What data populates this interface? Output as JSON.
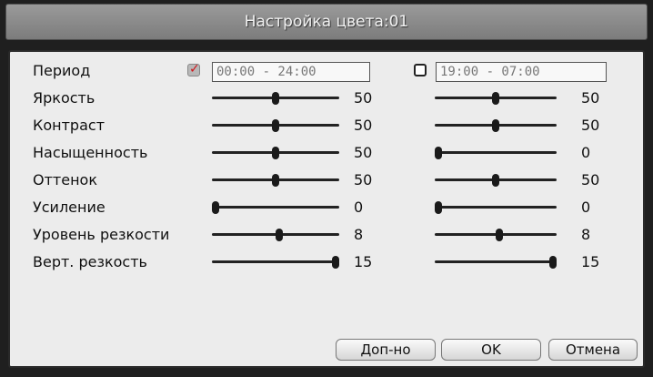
{
  "window": {
    "title": "Настройка цвета:01"
  },
  "period": {
    "label": "Период",
    "slot1": {
      "checked": true,
      "time": "00:00  -  24:00"
    },
    "slot2": {
      "checked": false,
      "time": "19:00  -  07:00"
    }
  },
  "rows": [
    {
      "label": "Яркость",
      "left": {
        "value": "50",
        "level": 0.5
      },
      "right": {
        "value": "50",
        "level": 0.5
      }
    },
    {
      "label": "Контраст",
      "left": {
        "value": "50",
        "level": 0.5
      },
      "right": {
        "value": "50",
        "level": 0.5
      }
    },
    {
      "label": "Насыщенность",
      "left": {
        "value": "50",
        "level": 0.5
      },
      "right": {
        "value": "0",
        "level": 0.0
      }
    },
    {
      "label": "Оттенок",
      "left": {
        "value": "50",
        "level": 0.5
      },
      "right": {
        "value": "50",
        "level": 0.5
      }
    },
    {
      "label": "Усиление",
      "left": {
        "value": "0",
        "level": 0.0
      },
      "right": {
        "value": "0",
        "level": 0.0
      }
    },
    {
      "label": "Уровень резкости",
      "left": {
        "value": "8",
        "level": 0.53
      },
      "right": {
        "value": "8",
        "level": 0.53
      }
    },
    {
      "label": "Верт. резкость",
      "left": {
        "value": "15",
        "level": 1.0
      },
      "right": {
        "value": "15",
        "level": 1.0
      }
    }
  ],
  "buttons": {
    "advanced": "Доп-но",
    "ok": "OK",
    "cancel": "Отмена"
  }
}
